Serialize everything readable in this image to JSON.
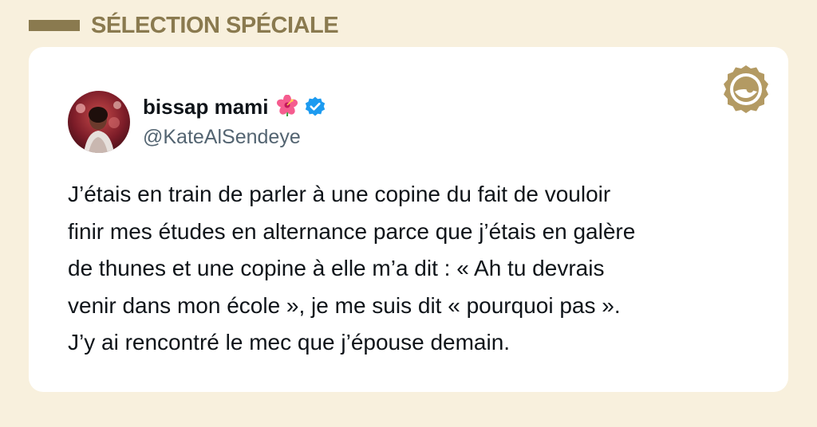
{
  "header": {
    "title": "SÉLECTION SPÉCIALE"
  },
  "tweet": {
    "author_name": "bissap mami",
    "author_emoji_icon": "hibiscus-flower-icon",
    "verified_icon": "verified-badge-icon",
    "handle": "@KateAlSendeye",
    "lines": [
      "J’étais en train de parler à une copine du fait de vouloir",
      "finir mes études en alternance parce que j’étais en galère",
      "de thunes et une copine à elle m’a dit : « Ah tu devrais",
      "venir dans mon école », je me suis dit « pourquoi pas ».",
      "J’y ai rencontré le mec que j’épouse demain."
    ]
  },
  "brand_icon": "gold-seal-logo-icon",
  "colors": {
    "background": "#f8f0dd",
    "accent_gold": "#8a7a4f",
    "card": "#ffffff",
    "text": "#0f1419",
    "handle": "#536471",
    "verified": "#1d9bf0"
  }
}
